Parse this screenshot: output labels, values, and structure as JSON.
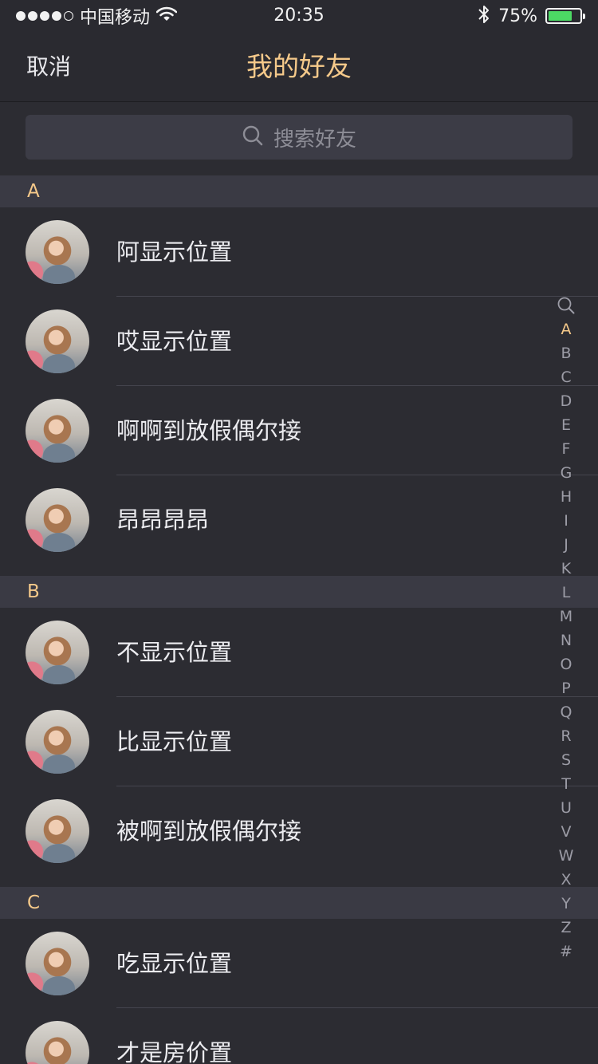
{
  "status_bar": {
    "carrier": "中国移动",
    "time": "20:35",
    "battery_percent": "75%",
    "battery_level": 0.75,
    "battery_color": "#4cd964"
  },
  "nav": {
    "cancel_label": "取消",
    "title": "我的好友"
  },
  "search": {
    "placeholder": "搜索好友",
    "icon": "search-icon"
  },
  "colors": {
    "accent": "#f5c98a",
    "background": "#2c2c32",
    "section_header_bg": "#3a3a44"
  },
  "sections": [
    {
      "letter": "A",
      "contacts": [
        {
          "name": "阿显示位置"
        },
        {
          "name": "哎显示位置"
        },
        {
          "name": "啊啊到放假偶尔接"
        },
        {
          "name": "昂昂昂昂"
        }
      ]
    },
    {
      "letter": "B",
      "contacts": [
        {
          "name": "不显示位置"
        },
        {
          "name": "比显示位置"
        },
        {
          "name": "被啊到放假偶尔接"
        }
      ]
    },
    {
      "letter": "C",
      "contacts": [
        {
          "name": "吃显示位置"
        },
        {
          "name": "才是房价置"
        }
      ]
    }
  ],
  "index_bar": {
    "active": "A",
    "letters": [
      "A",
      "B",
      "C",
      "D",
      "E",
      "F",
      "G",
      "H",
      "I",
      "J",
      "K",
      "L",
      "M",
      "N",
      "O",
      "P",
      "Q",
      "R",
      "S",
      "T",
      "U",
      "V",
      "W",
      "X",
      "Y",
      "Z",
      "#"
    ]
  }
}
